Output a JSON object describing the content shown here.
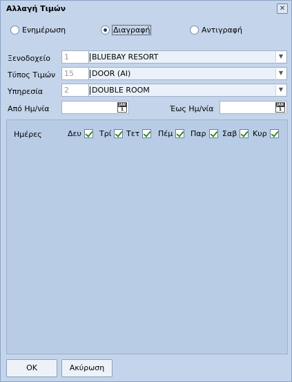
{
  "window": {
    "title": "Αλλαγή Τιμών",
    "close_label": "✕"
  },
  "mode": {
    "options": [
      {
        "label": "Ενημέρωση",
        "checked": false
      },
      {
        "label": "Διαγραφή",
        "checked": true
      },
      {
        "label": "Αντιγραφή",
        "checked": false
      }
    ]
  },
  "fields": {
    "hotel": {
      "label": "Ξενοδοχείο",
      "code": "1",
      "value": "BLUEBAY RESORT"
    },
    "price_type": {
      "label": "Τύπος Τιμών",
      "code": "15",
      "value": "DOOR (AI)"
    },
    "service": {
      "label": "Υπηρεσία",
      "code": "2",
      "value": "DOUBLE ROOM"
    },
    "date_from": {
      "label": "Από Ημ/νία",
      "value": ""
    },
    "date_to": {
      "label": "Έως Ημ/νία",
      "value": ""
    }
  },
  "calendar_icon": {
    "top": "JAN",
    "num": "1"
  },
  "days": {
    "label": "Ημέρες",
    "items": [
      {
        "label": "Δευ",
        "checked": true
      },
      {
        "label": "Τρί",
        "checked": true
      },
      {
        "label": "Τετ",
        "checked": true
      },
      {
        "label": "Πέμ",
        "checked": true
      },
      {
        "label": "Παρ",
        "checked": true
      },
      {
        "label": "Σαβ",
        "checked": true
      },
      {
        "label": "Κυρ",
        "checked": true
      }
    ]
  },
  "buttons": {
    "ok": "OK",
    "cancel": "Ακύρωση"
  }
}
